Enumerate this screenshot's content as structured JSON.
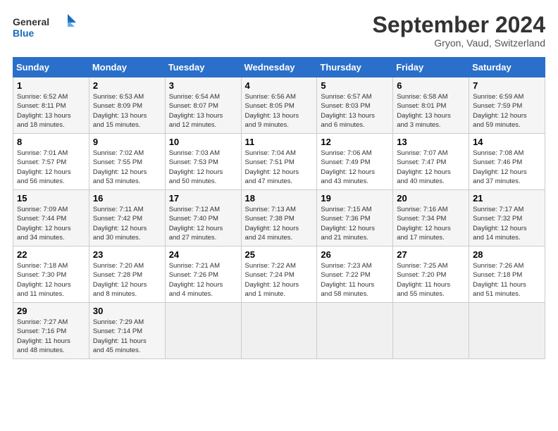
{
  "logo": {
    "line1": "General",
    "line2": "Blue"
  },
  "title": "September 2024",
  "subtitle": "Gryon, Vaud, Switzerland",
  "days_of_week": [
    "Sunday",
    "Monday",
    "Tuesday",
    "Wednesday",
    "Thursday",
    "Friday",
    "Saturday"
  ],
  "weeks": [
    [
      {
        "day": "1",
        "info": "Sunrise: 6:52 AM\nSunset: 8:11 PM\nDaylight: 13 hours\nand 18 minutes."
      },
      {
        "day": "2",
        "info": "Sunrise: 6:53 AM\nSunset: 8:09 PM\nDaylight: 13 hours\nand 15 minutes."
      },
      {
        "day": "3",
        "info": "Sunrise: 6:54 AM\nSunset: 8:07 PM\nDaylight: 13 hours\nand 12 minutes."
      },
      {
        "day": "4",
        "info": "Sunrise: 6:56 AM\nSunset: 8:05 PM\nDaylight: 13 hours\nand 9 minutes."
      },
      {
        "day": "5",
        "info": "Sunrise: 6:57 AM\nSunset: 8:03 PM\nDaylight: 13 hours\nand 6 minutes."
      },
      {
        "day": "6",
        "info": "Sunrise: 6:58 AM\nSunset: 8:01 PM\nDaylight: 13 hours\nand 3 minutes."
      },
      {
        "day": "7",
        "info": "Sunrise: 6:59 AM\nSunset: 7:59 PM\nDaylight: 12 hours\nand 59 minutes."
      }
    ],
    [
      {
        "day": "8",
        "info": "Sunrise: 7:01 AM\nSunset: 7:57 PM\nDaylight: 12 hours\nand 56 minutes."
      },
      {
        "day": "9",
        "info": "Sunrise: 7:02 AM\nSunset: 7:55 PM\nDaylight: 12 hours\nand 53 minutes."
      },
      {
        "day": "10",
        "info": "Sunrise: 7:03 AM\nSunset: 7:53 PM\nDaylight: 12 hours\nand 50 minutes."
      },
      {
        "day": "11",
        "info": "Sunrise: 7:04 AM\nSunset: 7:51 PM\nDaylight: 12 hours\nand 47 minutes."
      },
      {
        "day": "12",
        "info": "Sunrise: 7:06 AM\nSunset: 7:49 PM\nDaylight: 12 hours\nand 43 minutes."
      },
      {
        "day": "13",
        "info": "Sunrise: 7:07 AM\nSunset: 7:47 PM\nDaylight: 12 hours\nand 40 minutes."
      },
      {
        "day": "14",
        "info": "Sunrise: 7:08 AM\nSunset: 7:46 PM\nDaylight: 12 hours\nand 37 minutes."
      }
    ],
    [
      {
        "day": "15",
        "info": "Sunrise: 7:09 AM\nSunset: 7:44 PM\nDaylight: 12 hours\nand 34 minutes."
      },
      {
        "day": "16",
        "info": "Sunrise: 7:11 AM\nSunset: 7:42 PM\nDaylight: 12 hours\nand 30 minutes."
      },
      {
        "day": "17",
        "info": "Sunrise: 7:12 AM\nSunset: 7:40 PM\nDaylight: 12 hours\nand 27 minutes."
      },
      {
        "day": "18",
        "info": "Sunrise: 7:13 AM\nSunset: 7:38 PM\nDaylight: 12 hours\nand 24 minutes."
      },
      {
        "day": "19",
        "info": "Sunrise: 7:15 AM\nSunset: 7:36 PM\nDaylight: 12 hours\nand 21 minutes."
      },
      {
        "day": "20",
        "info": "Sunrise: 7:16 AM\nSunset: 7:34 PM\nDaylight: 12 hours\nand 17 minutes."
      },
      {
        "day": "21",
        "info": "Sunrise: 7:17 AM\nSunset: 7:32 PM\nDaylight: 12 hours\nand 14 minutes."
      }
    ],
    [
      {
        "day": "22",
        "info": "Sunrise: 7:18 AM\nSunset: 7:30 PM\nDaylight: 12 hours\nand 11 minutes."
      },
      {
        "day": "23",
        "info": "Sunrise: 7:20 AM\nSunset: 7:28 PM\nDaylight: 12 hours\nand 8 minutes."
      },
      {
        "day": "24",
        "info": "Sunrise: 7:21 AM\nSunset: 7:26 PM\nDaylight: 12 hours\nand 4 minutes."
      },
      {
        "day": "25",
        "info": "Sunrise: 7:22 AM\nSunset: 7:24 PM\nDaylight: 12 hours\nand 1 minute."
      },
      {
        "day": "26",
        "info": "Sunrise: 7:23 AM\nSunset: 7:22 PM\nDaylight: 11 hours\nand 58 minutes."
      },
      {
        "day": "27",
        "info": "Sunrise: 7:25 AM\nSunset: 7:20 PM\nDaylight: 11 hours\nand 55 minutes."
      },
      {
        "day": "28",
        "info": "Sunrise: 7:26 AM\nSunset: 7:18 PM\nDaylight: 11 hours\nand 51 minutes."
      }
    ],
    [
      {
        "day": "29",
        "info": "Sunrise: 7:27 AM\nSunset: 7:16 PM\nDaylight: 11 hours\nand 48 minutes."
      },
      {
        "day": "30",
        "info": "Sunrise: 7:29 AM\nSunset: 7:14 PM\nDaylight: 11 hours\nand 45 minutes."
      },
      {
        "day": "",
        "info": ""
      },
      {
        "day": "",
        "info": ""
      },
      {
        "day": "",
        "info": ""
      },
      {
        "day": "",
        "info": ""
      },
      {
        "day": "",
        "info": ""
      }
    ]
  ]
}
